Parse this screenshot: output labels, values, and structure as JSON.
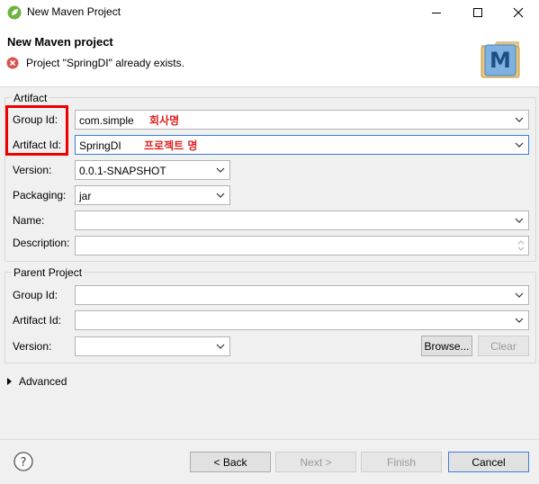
{
  "window": {
    "title": "New Maven Project"
  },
  "header": {
    "title": "New Maven project",
    "error_message": "Project \"SpringDI\" already exists."
  },
  "artifact": {
    "legend": "Artifact",
    "group_id_label": "Group Id:",
    "group_id_value": "com.simple",
    "group_id_note": "회사명",
    "artifact_id_label": "Artifact Id:",
    "artifact_id_value": "SpringDI",
    "artifact_id_note": "프로젝트 명",
    "version_label": "Version:",
    "version_value": "0.0.1-SNAPSHOT",
    "packaging_label": "Packaging:",
    "packaging_value": "jar",
    "name_label": "Name:",
    "name_value": "",
    "description_label": "Description:",
    "description_value": ""
  },
  "parent": {
    "legend": "Parent Project",
    "group_id_label": "Group Id:",
    "group_id_value": "",
    "artifact_id_label": "Artifact Id:",
    "artifact_id_value": "",
    "version_label": "Version:",
    "version_value": "",
    "browse_label": "Browse...",
    "clear_label": "Clear"
  },
  "advanced": {
    "label": "Advanced"
  },
  "footer": {
    "back_label": "< Back",
    "next_label": "Next >",
    "finish_label": "Finish",
    "cancel_label": "Cancel"
  },
  "colors": {
    "annotation": "#e02020",
    "highlight_box": "#ee0000",
    "focus_border": "#3c7fd3",
    "error_icon": "#d9534f"
  },
  "icons": {
    "app": "spring-leaf-icon",
    "error": "error-icon",
    "logo": "maven-m-icon",
    "help": "help-icon"
  }
}
